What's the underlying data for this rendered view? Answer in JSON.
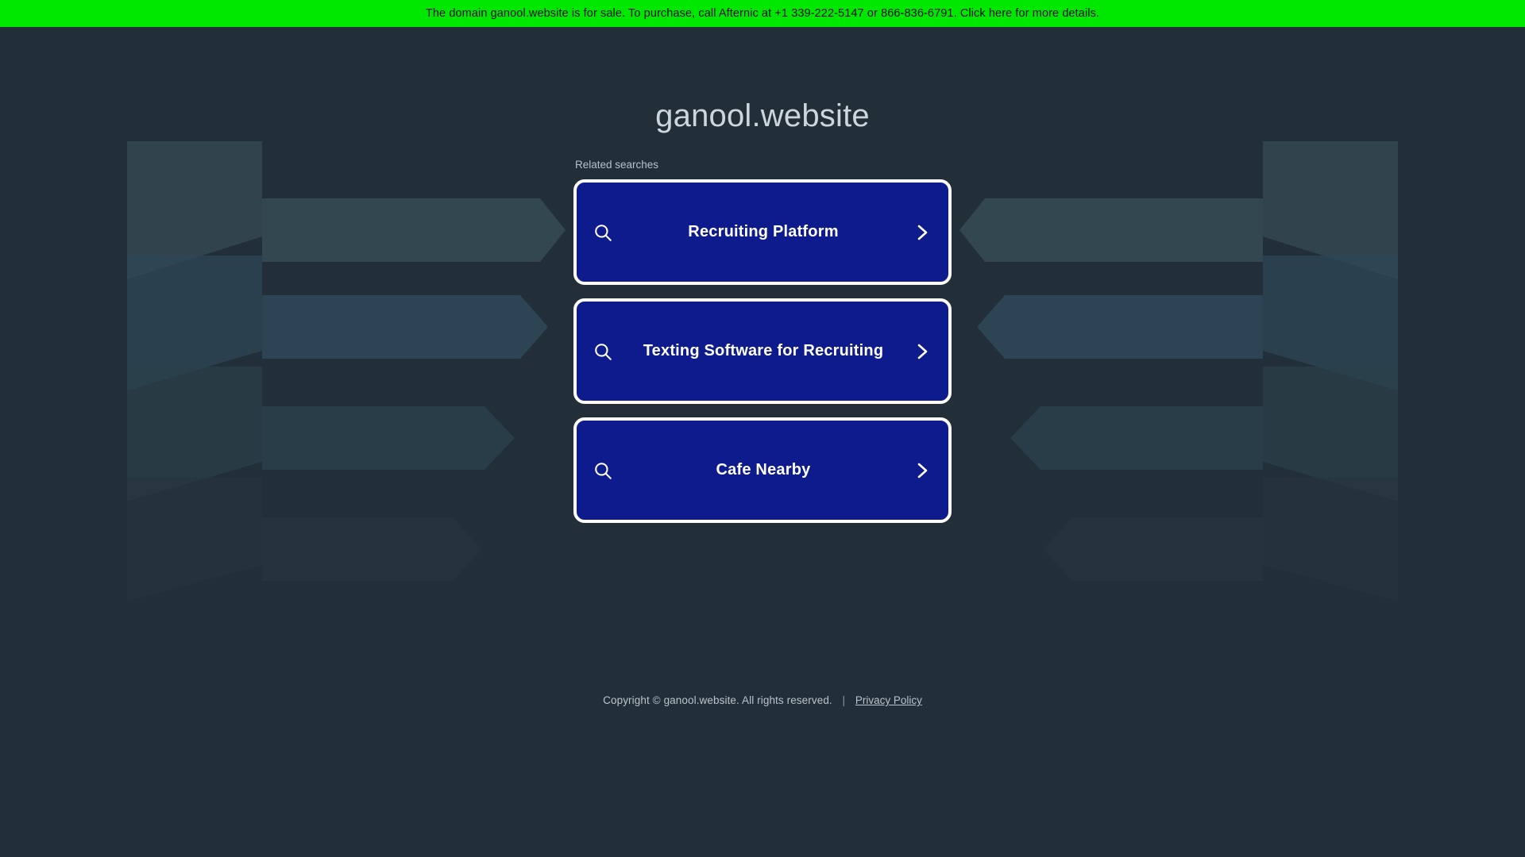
{
  "banner": {
    "text": "The domain ganool.website is for sale. To purchase, call Afternic at +1 339-222-5147 or 866-836-6791. Click here for more details.",
    "bg_color": "#00e800",
    "text_color": "#0a0a0a"
  },
  "page": {
    "background_color": "#222e38",
    "domain_title": "ganool.website",
    "title_color": "#ccd6dd"
  },
  "related": {
    "label": "Related searches",
    "card_bg_color": "#0d1b8c",
    "card_border_color": "#ffffff",
    "items": [
      {
        "label": "Recruiting Platform",
        "search_icon": "search-icon",
        "chevron_icon": "chevron-right-icon"
      },
      {
        "label": "Texting Software for Recruiting",
        "search_icon": "search-icon",
        "chevron_icon": "chevron-right-icon"
      },
      {
        "label": "Cafe Nearby",
        "search_icon": "search-icon",
        "chevron_icon": "chevron-right-icon"
      }
    ]
  },
  "footer": {
    "copyright": "Copyright © ganool.website.  All rights reserved.",
    "separator": "|",
    "privacy_label": "Privacy Policy"
  },
  "decoration": {
    "shape": "chevron-arrow-rows",
    "row_colors": [
      "#3a525c",
      "#2d4757",
      "#2b414c",
      "#27353f"
    ]
  }
}
